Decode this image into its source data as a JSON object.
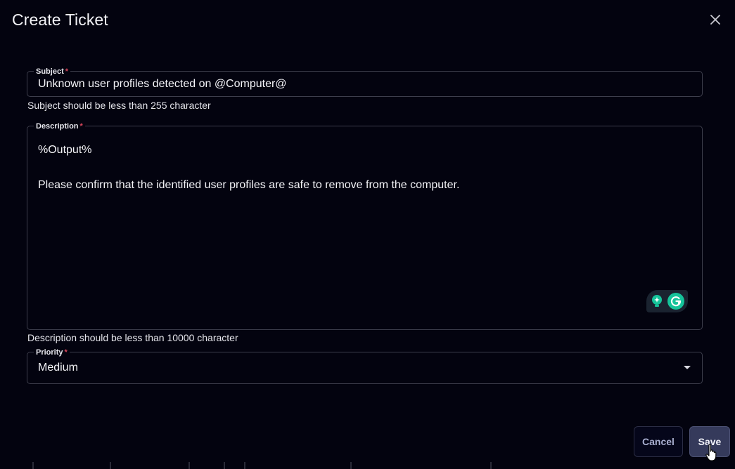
{
  "dialog": {
    "title": "Create Ticket"
  },
  "subject": {
    "label": "Subject",
    "required_mark": "*",
    "value": "Unknown user profiles detected on @Computer@",
    "helper": "Subject should be less than 255 character"
  },
  "description": {
    "label": "Description",
    "required_mark": "*",
    "lines": [
      "%Output%",
      "",
      "Please confirm that the identified user profiles are safe to remove from the computer."
    ],
    "helper": "Description should be less than 10000 character"
  },
  "priority": {
    "label": "Priority",
    "required_mark": "*",
    "value": "Medium"
  },
  "actions": {
    "cancel_label": "Cancel",
    "save_label": "Save"
  },
  "colors": {
    "background": "#03030f",
    "border": "#3d3e4c",
    "required": "#d8465b",
    "save_bg": "#353a5b",
    "cancel_text": "#a9afd0",
    "grammarly_green": "#15c39a"
  },
  "icons": {
    "close": "close-icon",
    "dropdown": "chevron-down-icon",
    "grammarly_assist": "lightbulb-icon",
    "grammarly_logo": "grammarly-icon",
    "pointer": "hand-cursor-icon"
  }
}
